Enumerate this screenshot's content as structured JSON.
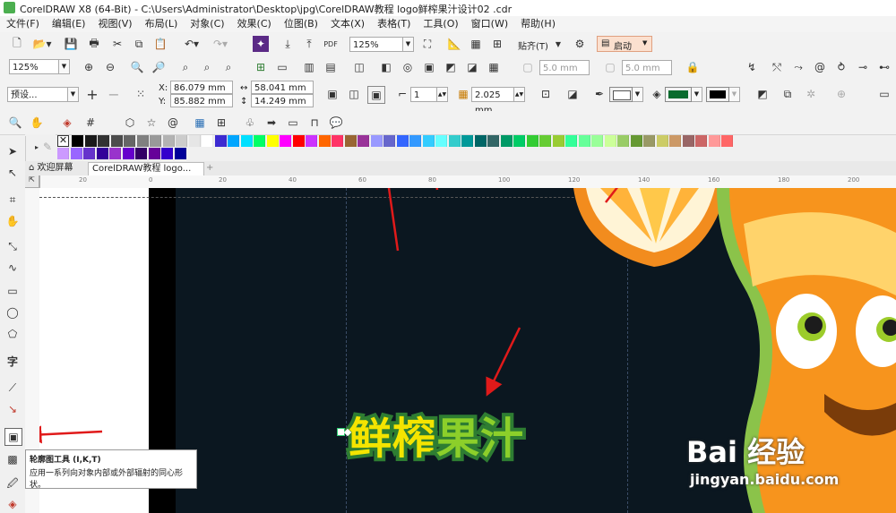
{
  "window": {
    "title": "CorelDRAW X8 (64-Bit) - C:\\Users\\Administrator\\Desktop\\jpg\\CorelDRAW教程 logo鲜榨果汁设计02 .cdr"
  },
  "menu": [
    "文件(F)",
    "编辑(E)",
    "视图(V)",
    "布局(L)",
    "对象(C)",
    "效果(C)",
    "位图(B)",
    "文本(X)",
    "表格(T)",
    "工具(O)",
    "窗口(W)",
    "帮助(H)"
  ],
  "standard_toolbar": {
    "zoom_value": "125%",
    "snap_label": "贴齐(T)",
    "launch_label": "启动"
  },
  "zoom_toolbar": {
    "zoom_value": "125%",
    "w1_value": "5.0 mm",
    "w2_value": "5.0 mm"
  },
  "property_bar": {
    "preset_value": "预设...",
    "x_label": "X:",
    "x_value": "86.079 mm",
    "y_label": "Y:",
    "y_value": "85.882 mm",
    "w_value": "58.041 mm",
    "h_value": "14.249 mm",
    "steps_value": "1",
    "offset_value": "2.025 mm",
    "outline_color": "#ffffff",
    "fill_color": "#0a6b2e",
    "obj_color": "#000000"
  },
  "palette": {
    "colors": [
      "#000000",
      "#1a1a1a",
      "#333333",
      "#4d4d4d",
      "#666666",
      "#808080",
      "#999999",
      "#b3b3b3",
      "#cccccc",
      "#e6e6e6",
      "#ffffff",
      "#3d2bd1",
      "#00a6ff",
      "#00e0ff",
      "#00ff66",
      "#ffff00",
      "#ff00ff",
      "#ff0000",
      "#cc33ff",
      "#ff6600",
      "#ff3366",
      "#996633",
      "#993399",
      "#9999ff",
      "#6666cc",
      "#3366ff",
      "#3399ff",
      "#33ccff",
      "#66ffff",
      "#33cccc",
      "#009999",
      "#006666",
      "#336666",
      "#009966",
      "#00cc66",
      "#33cc33",
      "#66cc33",
      "#99cc33",
      "#33ff99",
      "#66ff99",
      "#99ff99",
      "#ccff99",
      "#99cc66",
      "#669933",
      "#999966",
      "#cccc66",
      "#cc9966",
      "#996666",
      "#cc6666",
      "#ff9999",
      "#ff6666"
    ],
    "colors_row2": [
      "#cc99ff",
      "#9966ff",
      "#6633cc",
      "#330099",
      "#9933cc",
      "#6600cc",
      "#330066",
      "#660099",
      "#3300cc",
      "#000099"
    ]
  },
  "tabs": {
    "welcome_label": "欢迎屏幕",
    "doc_label": "CorelDRAW教程 logo...",
    "add_label": "+"
  },
  "ruler_marks": [
    "20",
    "0",
    "20",
    "40",
    "60",
    "80",
    "100",
    "120",
    "140",
    "160",
    "180",
    "200"
  ],
  "tooltip": {
    "title": "轮廓图工具 (I,K,T)",
    "body": "应用一系列向对象内部或外部辐射的同心形状。"
  },
  "canvas": {
    "logo_text_part1": "鲜榨",
    "logo_text_part2": "果汁"
  },
  "watermark": {
    "brand": "Bai 经验",
    "url": "jingyan.baidu.com"
  }
}
